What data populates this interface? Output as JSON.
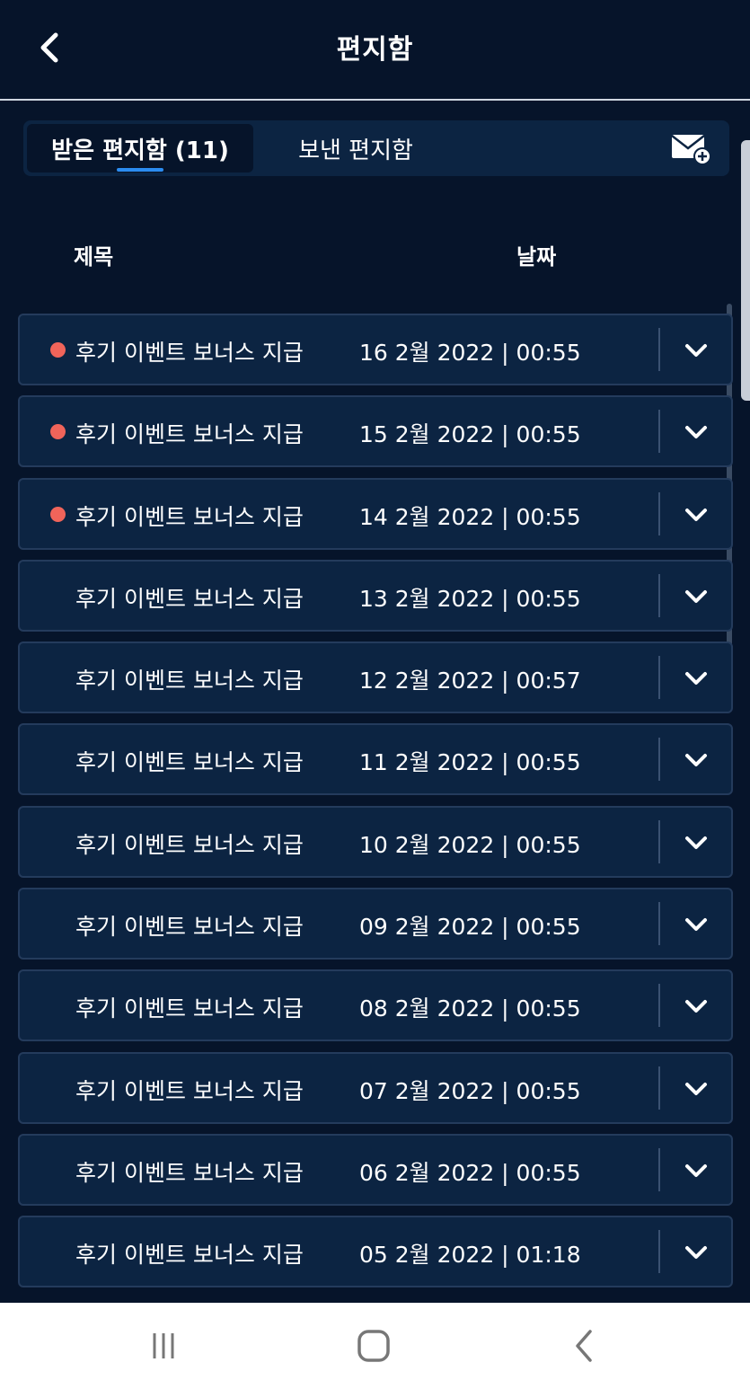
{
  "header": {
    "title": "편지함",
    "back_icon": "chevron-left-icon"
  },
  "tabs": {
    "inbox_label": "받은 편지함 (11)",
    "sent_label": "보낸 편지함",
    "compose_icon": "mail-plus-icon"
  },
  "columns": {
    "subject": "제목",
    "date": "날짜"
  },
  "colors": {
    "unread_dot": "#f0645a",
    "active_tab_underline": "#2b8cf0",
    "background": "#06142a",
    "row": "#0c2442"
  },
  "messages": [
    {
      "subject": "후기 이벤트 보너스 지급",
      "date": "16 2월 2022 | 00:55",
      "unread": true
    },
    {
      "subject": "후기 이벤트 보너스 지급",
      "date": "15 2월 2022 | 00:55",
      "unread": true
    },
    {
      "subject": "후기 이벤트 보너스 지급",
      "date": "14 2월 2022 | 00:55",
      "unread": true
    },
    {
      "subject": "후기 이벤트 보너스 지급",
      "date": "13 2월 2022 | 00:55",
      "unread": false
    },
    {
      "subject": "후기 이벤트 보너스 지급",
      "date": "12 2월 2022 | 00:57",
      "unread": false
    },
    {
      "subject": "후기 이벤트 보너스 지급",
      "date": "11 2월 2022 | 00:55",
      "unread": false
    },
    {
      "subject": "후기 이벤트 보너스 지급",
      "date": "10 2월 2022 | 00:55",
      "unread": false
    },
    {
      "subject": "후기 이벤트 보너스 지급",
      "date": "09 2월 2022 | 00:55",
      "unread": false
    },
    {
      "subject": "후기 이벤트 보너스 지급",
      "date": "08 2월 2022 | 00:55",
      "unread": false
    },
    {
      "subject": "후기 이벤트 보너스 지급",
      "date": "07 2월 2022 | 00:55",
      "unread": false
    },
    {
      "subject": "후기 이벤트 보너스 지급",
      "date": "06 2월 2022 | 00:55",
      "unread": false
    },
    {
      "subject": "후기 이벤트 보너스 지급",
      "date": "05 2월 2022 | 01:18",
      "unread": false
    }
  ],
  "navbar": {
    "recent_icon": "recent-apps-icon",
    "home_icon": "home-icon",
    "back_icon": "back-icon"
  }
}
